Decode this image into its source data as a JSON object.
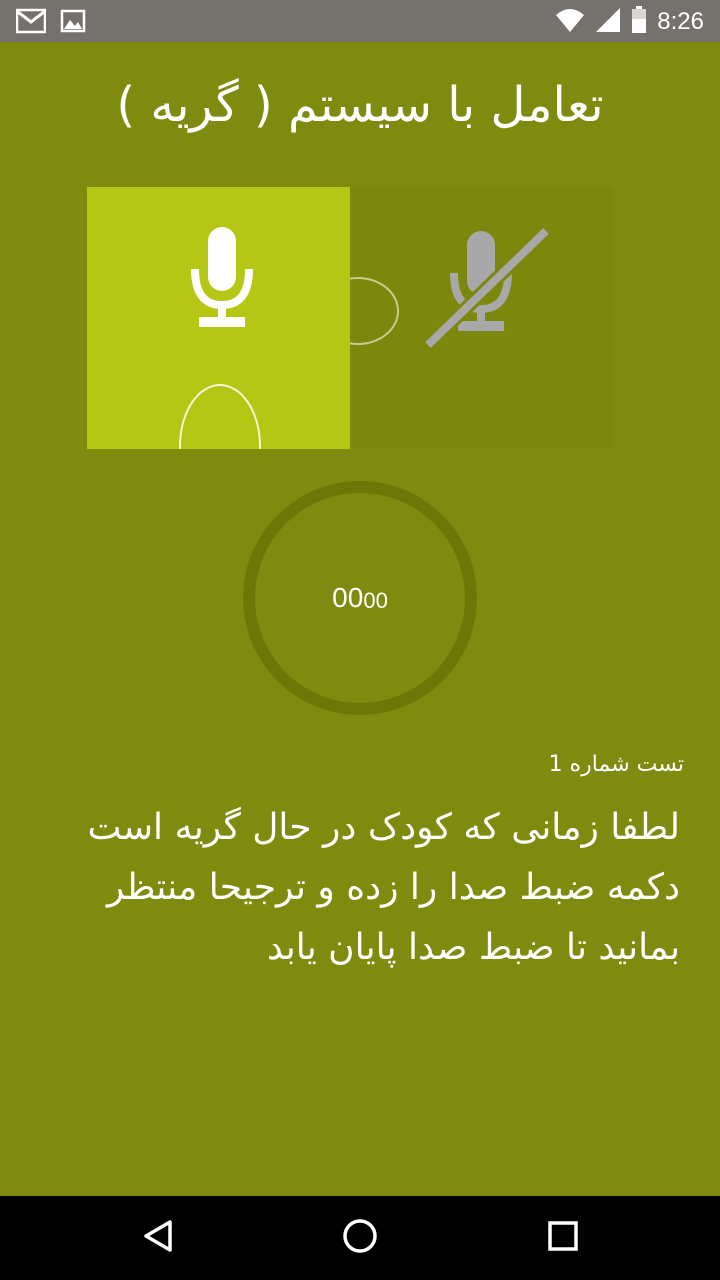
{
  "status_bar": {
    "time": "8:26",
    "icons": [
      "gmail-icon",
      "image-icon",
      "wifi-icon",
      "signal-icon",
      "battery-icon"
    ]
  },
  "page": {
    "title": "تعامل با سیستم ( گریه )"
  },
  "mic": {
    "active_icon": "microphone-icon",
    "muted_icon": "microphone-off-icon"
  },
  "timer": {
    "main": "00",
    "sub": "00"
  },
  "test": {
    "label": "تست شماره 1",
    "instruction_lines": [
      "لطفا زمانی که کودک در حال گریه است",
      "دکمه ضبط صدا را زده و ترجیحا منتظر",
      "بمانید تا ضبط صدا پایان یابد"
    ]
  },
  "nav": {
    "icons": [
      "back-icon",
      "home-icon",
      "recents-icon"
    ]
  },
  "colors": {
    "background": "#7f8b0e",
    "active_panel": "#b5c614",
    "muted_panel": "#7c870d",
    "status_bar": "#75716d"
  }
}
